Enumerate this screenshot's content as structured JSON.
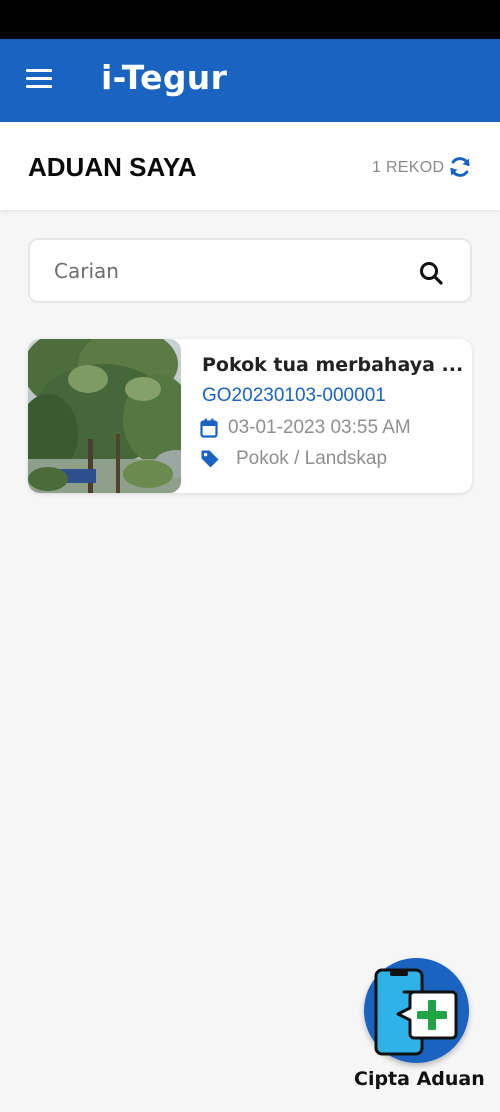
{
  "app": {
    "title": "i-Tegur",
    "brand_color": "#1a63c0"
  },
  "header": {
    "title": "ADUAN SAYA",
    "record_count": "1 REKOD",
    "refresh_icon": "refresh-icon"
  },
  "search": {
    "placeholder": "Carian",
    "value": "",
    "icon": "search-icon"
  },
  "complaints": [
    {
      "title": "Pokok tua merbahaya ...",
      "reference": "GO20230103-000001",
      "datetime": "03-01-2023 03:55 AM",
      "category": "Pokok / Landskap",
      "date_icon": "calendar-icon",
      "category_icon": "tag-icon",
      "accent_color": "#1a63c0"
    }
  ],
  "fab": {
    "label": "Cipta Aduan",
    "icon": "new-complaint-phone-icon"
  }
}
